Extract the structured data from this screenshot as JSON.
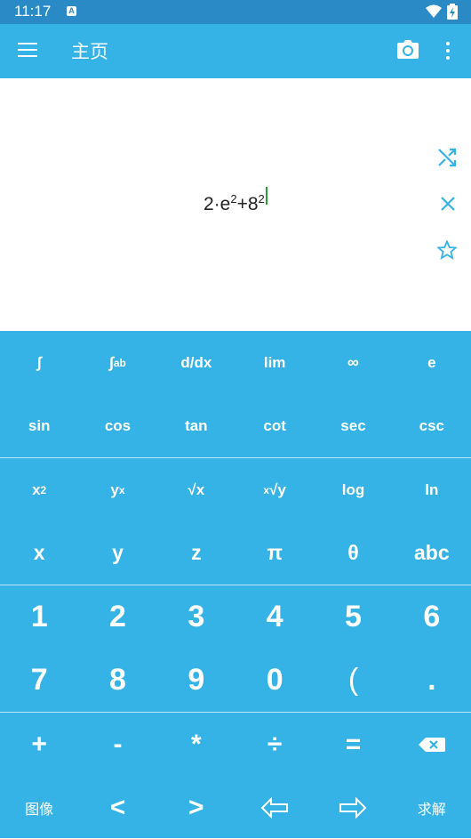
{
  "status_bar": {
    "time": "11:17",
    "notification": "A"
  },
  "app_bar": {
    "title": "主页",
    "menu_icon": "hamburger-menu-icon",
    "camera_icon": "camera-icon",
    "more_icon": "more-vert-icon"
  },
  "display": {
    "expression": {
      "coef": "2·e",
      "exp1": "2",
      "plus": "+8",
      "exp2": "2"
    },
    "side_icons": [
      "shuffle-icon",
      "clear-icon",
      "star-icon"
    ],
    "accent_color": "#35b2e6",
    "cursor_color": "#2e9b3a"
  },
  "keypad": {
    "row1": [
      "∫",
      "∫",
      "a",
      "b",
      "d/dx",
      "lim",
      "∞",
      "e"
    ],
    "row2": [
      "sin",
      "cos",
      "tan",
      "cot",
      "sec",
      "csc"
    ],
    "row3": {
      "x2_base": "x",
      "x2_exp": "2",
      "yx_base": "y",
      "yx_exp": "x",
      "sqrt": "√x",
      "root_idx": "x",
      "root_body": "√y",
      "log": "log",
      "ln": "ln"
    },
    "row4": [
      "x",
      "y",
      "z",
      "π",
      "θ",
      "abc"
    ],
    "row5": [
      "1",
      "2",
      "3",
      "4",
      "5",
      "6"
    ],
    "row6": [
      "7",
      "8",
      "9",
      "0",
      "(",
      "."
    ],
    "row7": [
      "+",
      "-",
      "*",
      "÷",
      "="
    ],
    "row8": {
      "graph": "图像",
      "lt": "<",
      "gt": ">",
      "solve": "求解"
    },
    "icons": {
      "backspace": "backspace-icon",
      "left": "arrow-left-icon",
      "right": "arrow-right-icon"
    }
  }
}
